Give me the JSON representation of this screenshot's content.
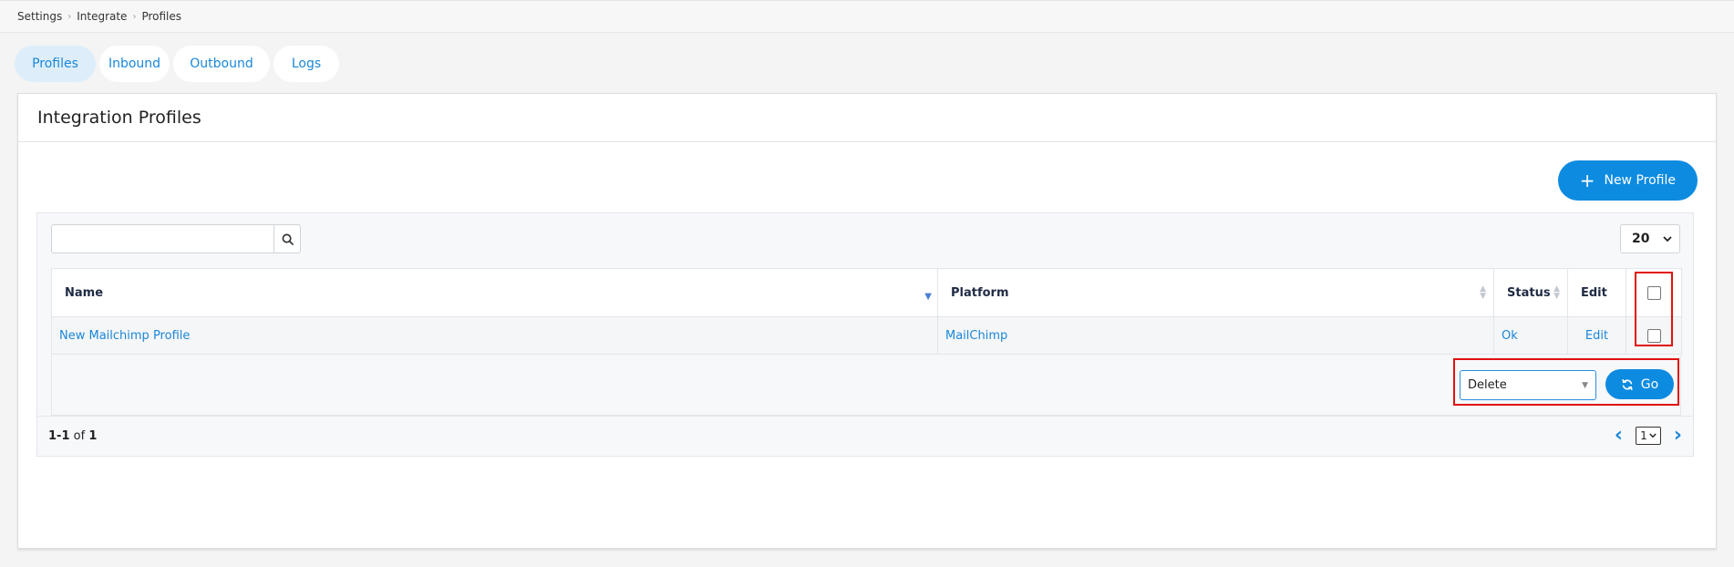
{
  "breadcrumb": [
    "Settings",
    "Integrate",
    "Profiles"
  ],
  "tabs": [
    {
      "label": "Profiles",
      "active": true
    },
    {
      "label": "Inbound",
      "active": false
    },
    {
      "label": "Outbound",
      "active": false
    },
    {
      "label": "Logs",
      "active": false
    }
  ],
  "card": {
    "title": "Integration Profiles"
  },
  "actions": {
    "new_profile_label": "New Profile",
    "plus_icon": "plus-icon"
  },
  "search": {
    "value": "",
    "icon": "search-icon"
  },
  "per_page": "20",
  "table": {
    "columns": [
      "Name",
      "Platform",
      "Status",
      "Edit"
    ],
    "rows": [
      {
        "name": "New Mailchimp Profile",
        "platform": "MailChimp",
        "status": "Ok",
        "edit": "Edit"
      }
    ]
  },
  "bulk": {
    "selected_action": "Delete",
    "go_label": "Go",
    "go_icon": "refresh-icon"
  },
  "pagination": {
    "range": "1-1",
    "of_label": "of",
    "total": "1",
    "current_page": "1"
  },
  "colors": {
    "accent": "#0d8be0",
    "link": "#1a87d8",
    "highlight": "#e01010"
  }
}
